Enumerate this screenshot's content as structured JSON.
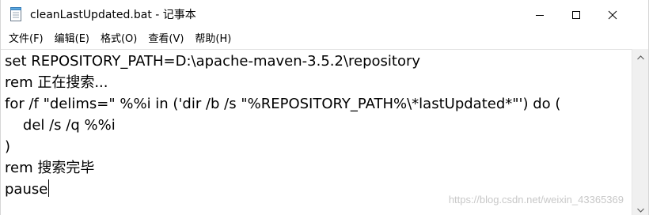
{
  "window": {
    "title": "cleanLastUpdated.bat - 记事本",
    "icon": "notepad-icon"
  },
  "caption_buttons": {
    "minimize_icon": "minimize-icon",
    "maximize_icon": "maximize-icon",
    "close_icon": "close-icon"
  },
  "menu": {
    "items": [
      {
        "label": "文件(F)"
      },
      {
        "label": "编辑(E)"
      },
      {
        "label": "格式(O)"
      },
      {
        "label": "查看(V)"
      },
      {
        "label": "帮助(H)"
      }
    ]
  },
  "editor": {
    "lines": [
      "set REPOSITORY_PATH=D:\\apache-maven-3.5.2\\repository",
      "rem 正在搜索...",
      "for /f \"delims=\" %%i in ('dir /b /s \"%REPOSITORY_PATH%\\*lastUpdated*\"') do (",
      "    del /s /q %%i",
      ")",
      "rem 搜索完毕",
      "pause"
    ]
  },
  "watermark": "https://blog.csdn.net/weixin_43365369",
  "colors": {
    "background": "#ffffff",
    "text": "#000000",
    "scrollbar": "#f0f0f0",
    "watermark": "#c8c8c8"
  }
}
